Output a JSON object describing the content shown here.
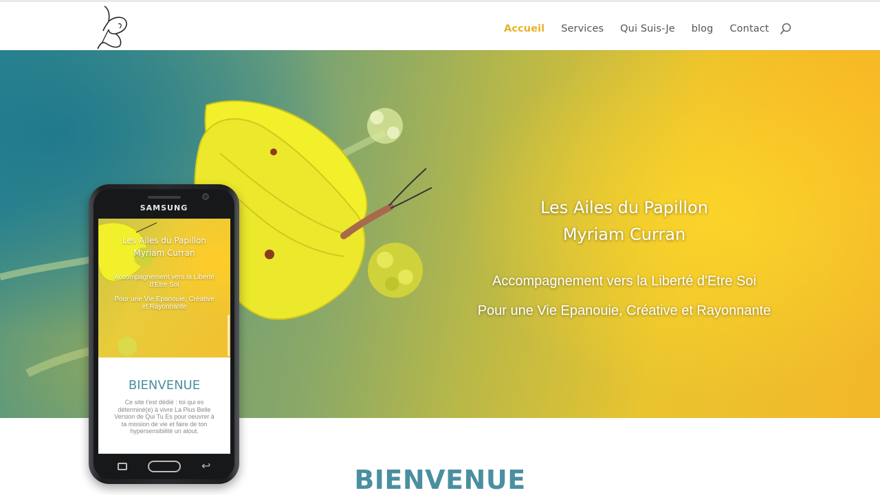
{
  "site": {
    "logo_icon": "butterfly-logo-icon"
  },
  "nav": {
    "items": [
      {
        "label": "Accueil",
        "active": true
      },
      {
        "label": "Services",
        "active": false
      },
      {
        "label": "Qui Suis-Je",
        "active": false
      },
      {
        "label": "blog",
        "active": false
      },
      {
        "label": "Contact",
        "active": false
      }
    ],
    "search_icon": "search-icon",
    "active_color": "#e8b22a"
  },
  "hero": {
    "title_line1": "Les Ailes du Papillon",
    "title_line2": "Myriam Curran",
    "subtitle1": "Accompagnement vers la Liberté d'Etre Soi",
    "subtitle2": "Pour une Vie Epanouie, Créative et Rayonnante"
  },
  "main": {
    "welcome_heading": "BIENVENUE",
    "heading_color": "#4a8fa0"
  },
  "phone": {
    "brand": "SAMSUNG",
    "screen": {
      "title_line1": "Les Ailes du Papillon",
      "title_line2": "Myriam Curran",
      "subtitle1": "Accompagnement vers la Liberté d'Etre Soi",
      "subtitle2": "Pour une Vie Epanouie, Créative et Rayonnante",
      "welcome_heading": "BIENVENUE",
      "body": "Ce site t'est dédié : toi qui es déterminé(e) à vivre La Plus Belle Version de Qui Tu Es pour oeuvrer à ta mission de vie et faire de ton hypersensibilité un atout."
    },
    "button_icons": [
      "recent-apps-icon",
      "home-button-icon",
      "back-icon"
    ]
  }
}
